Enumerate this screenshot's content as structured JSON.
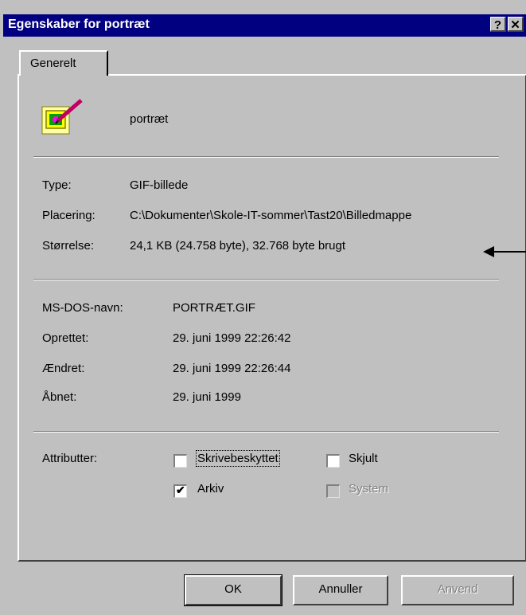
{
  "window": {
    "title": "Egenskaber for portræt",
    "help_label": "?",
    "close_label": "✕"
  },
  "tabs": [
    {
      "label": "Generelt"
    }
  ],
  "file": {
    "name": "portræt",
    "icon": "gif-image-icon"
  },
  "info1": {
    "type_label": "Type:",
    "type_value": "GIF-billede",
    "location_label": "Placering:",
    "location_value": "C:\\Dokumenter\\Skole-IT-sommer\\Tast20\\Billedmappe",
    "size_label": "Størrelse:",
    "size_value": "24,1 KB (24.758 byte), 32.768 byte brugt"
  },
  "info2": {
    "msdos_label": "MS-DOS-navn:",
    "msdos_value": "PORTRÆT.GIF",
    "created_label": "Oprettet:",
    "created_value": "29. juni 1999 22:26:42",
    "modified_label": "Ændret:",
    "modified_value": "29. juni 1999 22:26:44",
    "accessed_label": "Åbnet:",
    "accessed_value": "29. juni 1999"
  },
  "attributes": {
    "label": "Attributter:",
    "readonly": {
      "label": "Skrivebeskyttet",
      "checked": false
    },
    "hidden": {
      "label": "Skjult",
      "checked": false
    },
    "archive": {
      "label": "Arkiv",
      "checked": true,
      "mark": "✔"
    },
    "system": {
      "label": "System",
      "checked": false,
      "disabled": true
    }
  },
  "buttons": {
    "ok": "OK",
    "cancel": "Annuller",
    "apply": "Anvend"
  },
  "colors": {
    "title_bar": "#000080",
    "face": "#c0c0c0"
  }
}
